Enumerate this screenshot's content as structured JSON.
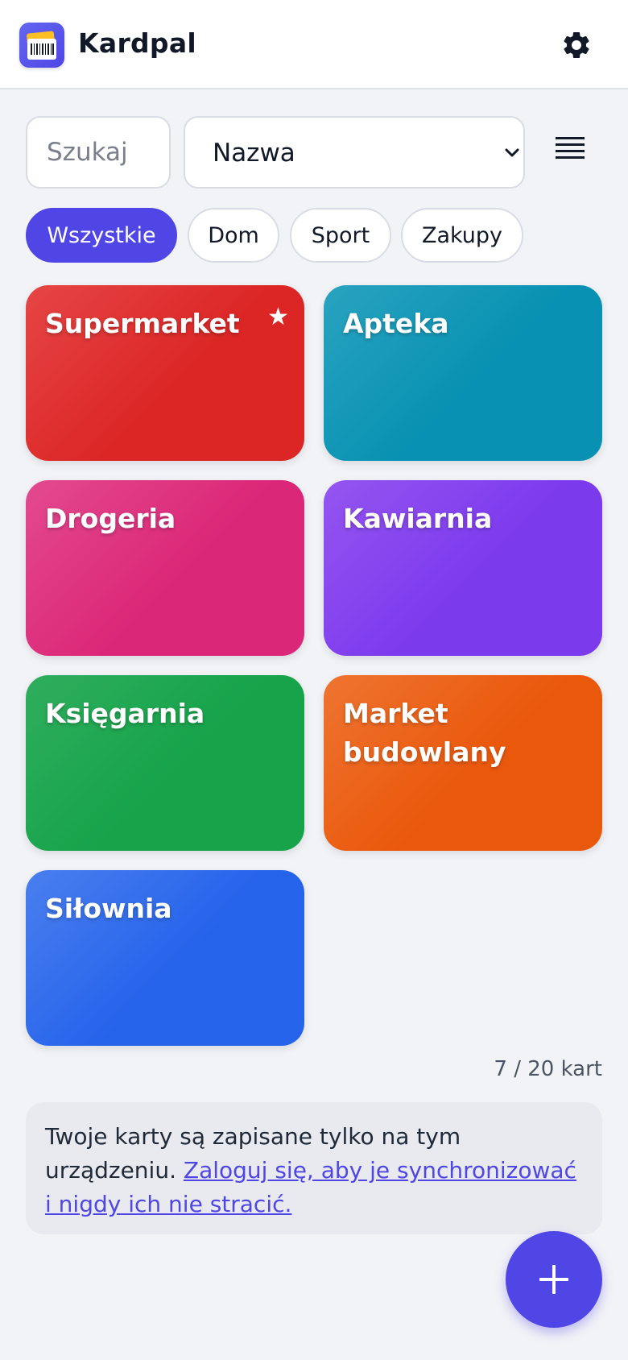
{
  "app": {
    "title": "Kardpal"
  },
  "search": {
    "placeholder": "Szukaj"
  },
  "sort": {
    "selected": "Nazwa"
  },
  "filters": [
    {
      "label": "Wszystkie",
      "active": true
    },
    {
      "label": "Dom",
      "active": false
    },
    {
      "label": "Sport",
      "active": false
    },
    {
      "label": "Zakupy",
      "active": false
    }
  ],
  "cards": [
    {
      "name": "Supermarket",
      "favorite": true,
      "color_from": "#e64545",
      "color_to": "#dc2626"
    },
    {
      "name": "Apteka",
      "favorite": false,
      "color_from": "#29a3c0",
      "color_to": "#0891b2"
    },
    {
      "name": "Drogeria",
      "favorite": false,
      "color_from": "#e34a8f",
      "color_to": "#db2777"
    },
    {
      "name": "Kawiarnia",
      "favorite": false,
      "color_from": "#9455f0",
      "color_to": "#7c3aed"
    },
    {
      "name": "Księgarnia",
      "favorite": false,
      "color_from": "#2fae5d",
      "color_to": "#16a34a"
    },
    {
      "name": "Market budowlany",
      "favorite": false,
      "color_from": "#ee7430",
      "color_to": "#ea580c"
    },
    {
      "name": "Siłownia",
      "favorite": false,
      "color_from": "#4a7fee",
      "color_to": "#2563eb"
    }
  ],
  "card_count": "7 / 20 kart",
  "notice": {
    "text": "Twoje karty są zapisane tylko na tym urządzeniu. ",
    "link": "Zaloguj się, aby je synchronizować i nigdy ich nie stracić."
  },
  "icons": {
    "logo": "barcode-card-icon",
    "settings": "gear-icon",
    "sort_dropdown": "chevron-down-icon",
    "view_toggle": "list-view-icon",
    "favorite": "star-icon",
    "add": "plus-icon"
  },
  "colors": {
    "accent": "#4f46e5",
    "background": "#f2f3f7"
  }
}
